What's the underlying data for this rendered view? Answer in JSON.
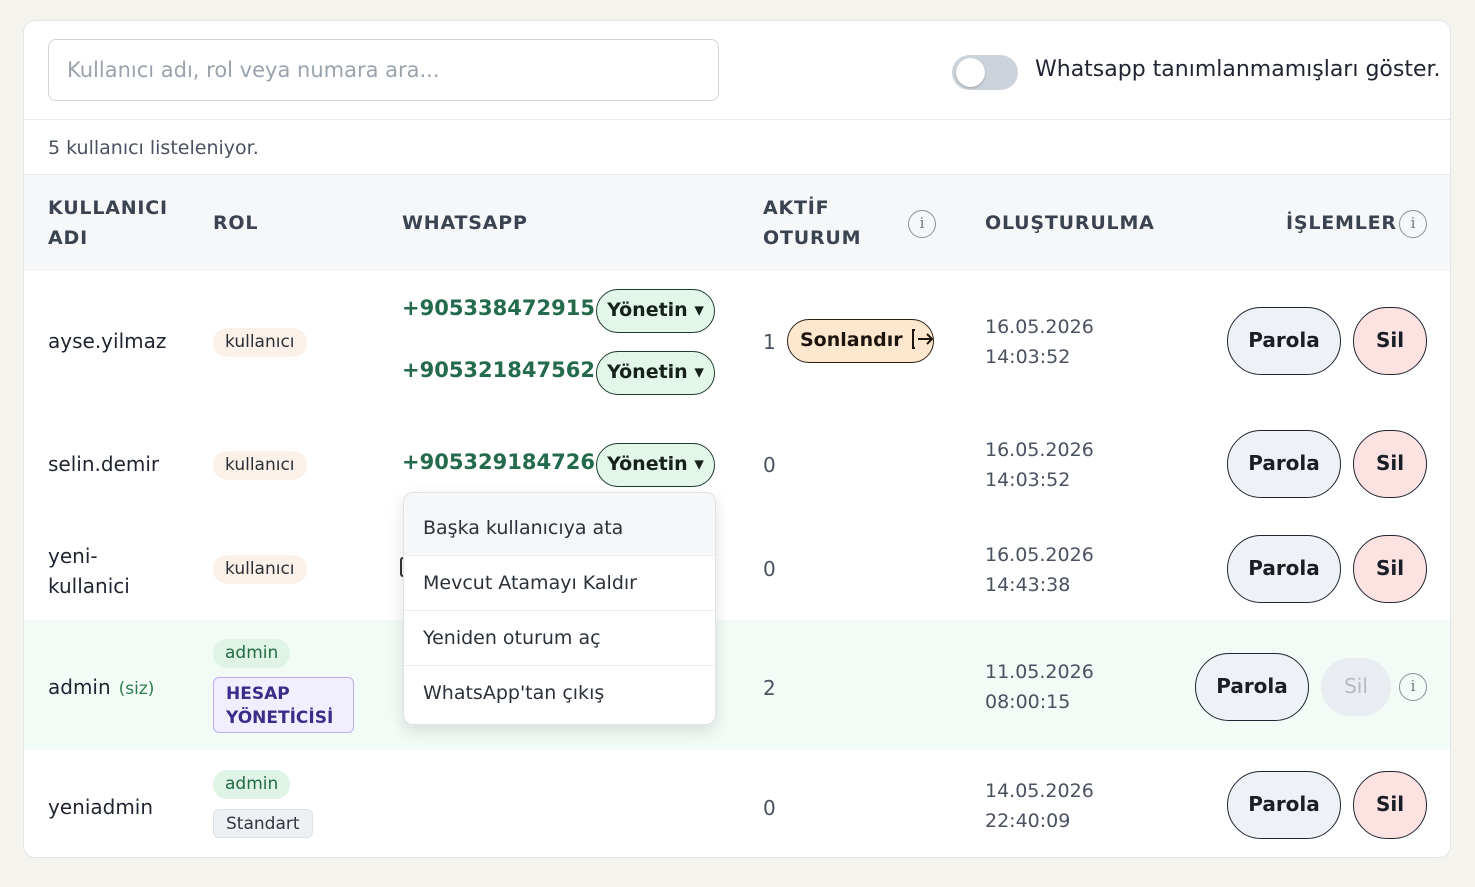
{
  "search": {
    "placeholder": "Kullanıcı adı, rol veya numara ara..."
  },
  "toggle": {
    "label": "Whatsapp tanımlanmamışları göster.",
    "on": false
  },
  "count_text": "5 kullanıcı listeleniyor.",
  "headers": {
    "username": [
      "KULLANICI",
      "ADI"
    ],
    "role": "ROL",
    "whatsapp": "WHATSAPP",
    "active": [
      "AKTİF",
      "OTURUM"
    ],
    "created": "OLUŞTURULMA",
    "actions": "İŞLEMLER",
    "info_glyph": "i"
  },
  "rows": [
    {
      "username": "ayse.yilmaz",
      "role": "kullanıcı",
      "phones": [
        "+905338472915",
        "+905321847562"
      ],
      "active": "1",
      "end_session": "Sonlandır",
      "date": "16.05.2026",
      "time": "14:03:52"
    },
    {
      "username": "selin.demir",
      "role": "kullanıcı",
      "phones": [
        "+905329184726"
      ],
      "active": "0",
      "date": "16.05.2026",
      "time": "14:03:52"
    },
    {
      "username_lines": [
        "yeni-",
        "kullanici"
      ],
      "role": "kullanıcı",
      "active": "0",
      "date": "16.05.2026",
      "time": "14:43:38"
    },
    {
      "username": "admin",
      "self_tag": "(siz)",
      "role": "admin",
      "sub_role": [
        "HESAP",
        "YÖNETİCİSİ"
      ],
      "active": "2",
      "date": "11.05.2026",
      "time": "08:00:15"
    },
    {
      "username": "yeniadmin",
      "role": "admin",
      "sub_role": "Standart",
      "active": "0",
      "date": "14.05.2026",
      "time": "22:40:09"
    }
  ],
  "buttons": {
    "manage": "Yönetin ▾",
    "password": "Parola",
    "delete": "Sil"
  },
  "dropdown": [
    "Başka kullanıcıya ata",
    "Mevcut Atamayı Kaldır",
    "Yeniden oturum aç",
    "WhatsApp'tan çıkış"
  ],
  "colors": {
    "phone": "#236b4c",
    "manage_bg": "#e2f6ea",
    "end_bg": "#fde7cf",
    "delete_bg": "#fde2e2",
    "self_row_bg": "#f3fbf7"
  }
}
